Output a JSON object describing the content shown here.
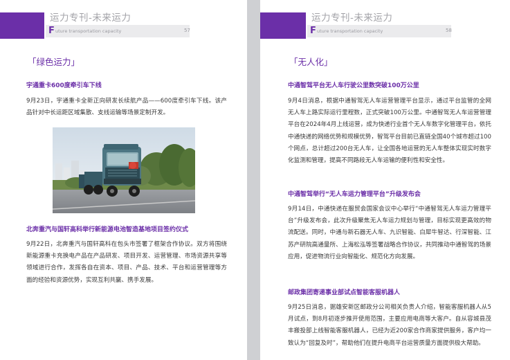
{
  "left_page": {
    "header_title": "运力专刊-未来运力",
    "header_initial": "F",
    "header_subtitle": "uture transportation capacity",
    "page_number": "57",
    "section_heading": "「绿色运力」",
    "articles": [
      {
        "title": "宇通重卡600度牵引车下线",
        "body": "9月23日，宇通重卡全新正向研发长续航产品——600度牵引车下线。该产品针对中长运距区域集散、支线运输等场景定制开发。"
      },
      {
        "title": "北奔重汽与国轩高科举行新能源电池智造基地项目签约仪式",
        "body": "9月22日，北奔重汽与国轩高科在包头市签署了框架合作协议。双方将围绕新能源重卡充换电产品在产品研发、项目开发、运营管理、市场资源共享等领域进行合作，发挥各自在资本、项目、产品、技术、平台和运营管理等方面的经验和资源优势，实现互利共赢、携手发展。"
      }
    ]
  },
  "right_page": {
    "header_title": "运力专刊-未来运力",
    "header_initial": "F",
    "header_subtitle": "uture transportation capacity",
    "page_number": "58",
    "section_heading": "「无人化」",
    "articles": [
      {
        "title": "中通智驾平台无人车行驶公里数突破100万公里",
        "body": "9月4日消息，根据中通智驾无人车运营管理平台显示，通过平台监管的全网无人车上路实际运行里程数，正式突破100万公里。中通智驾无人车运营管理平台在2024年4月上线运营，成为快递行业首个无人车数字化管理平台，依托中通快递的网络优势和规模优势，智驾平台目前已直链全国40个城市超过100个网点，总计超过200台无人车，让全国各地运营的无人车整体实现实时数字化监测和管理，提高不同路段无人车运输的便利性和安全性。"
      },
      {
        "title": "中通智驾举行“无人车运力管理平台”升级发布会",
        "body": "9月14日，中通快递在服贸会国家会议中心举行“中通智驾无人车运力管理平台”升级发布会，此次升级聚焦无人车运力规划与管理，目标实现更高效的物流配送。同时，中通与新石器无人车、九识智能、白犀牛智达、行深智能、江苏产研院高通量所、上海松泓等签署战略合作协议，共同推动中通智驾的场景应用，促进物流行业向智能化、规范化方向发展。"
      },
      {
        "title": "邮政集团寄递事业部试点智能客服机器人",
        "body": "9月25日消息，据雄安新区邮政分公司相关负责人介绍，智能客服机器人从5月试点，到8月初逐步推开使用范围，主要应用电商等大客户。自从容城县茂丰搬投部上线智能客服机器人，已经为近200家合作商家提供服务，客户均一致认为“回复及时”，帮助他们在提升电商平台运营质量方面提供极大帮助。"
      }
    ]
  },
  "colors": {
    "accent": "#6b2fa8",
    "header_text": "#a3a3a8",
    "body_text": "#3a3a3a"
  }
}
